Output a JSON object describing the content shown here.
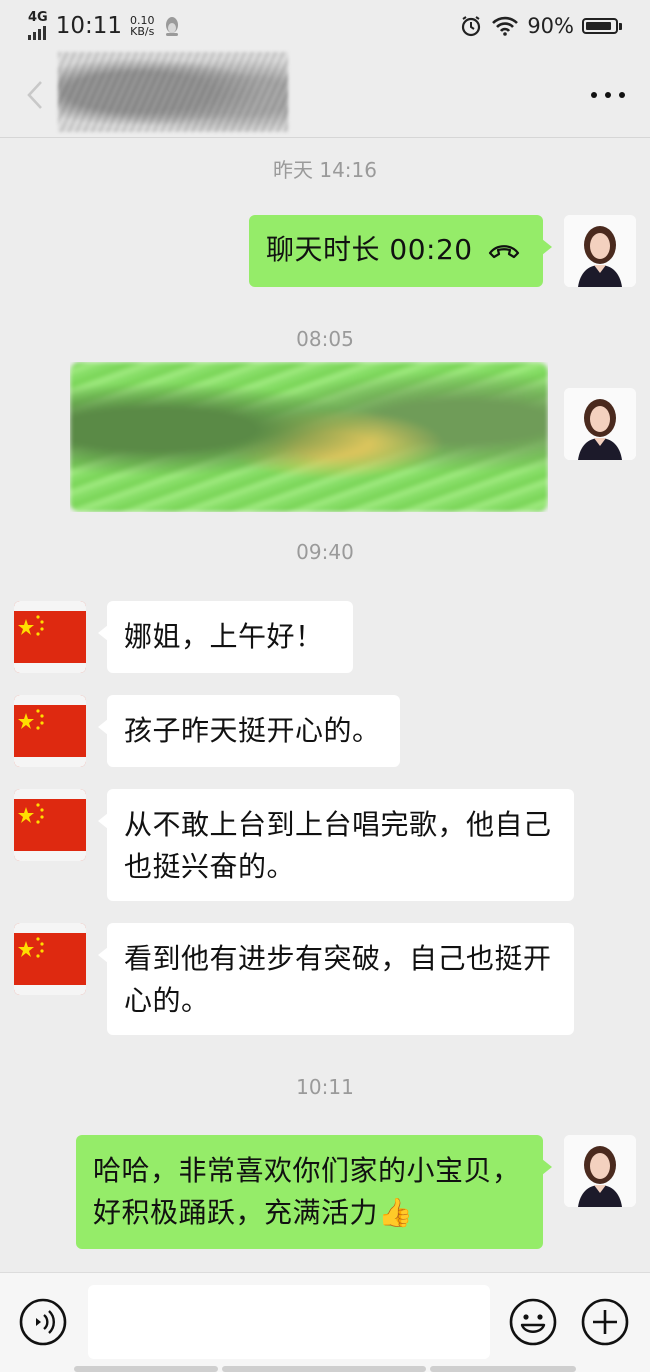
{
  "status_bar": {
    "network": "4G",
    "time": "10:11",
    "speed_value": "0.10",
    "speed_unit": "KB/s",
    "battery": "90%",
    "battery_level": 0.9
  },
  "timestamps": {
    "t1": "昨天 14:16",
    "t2": "08:05",
    "t3": "09:40",
    "t4": "10:11"
  },
  "messages": {
    "call": {
      "label": "聊天时长 00:20"
    },
    "m1": "娜姐，上午好！",
    "m2": "孩子昨天挺开心的。",
    "m3": "从不敢上台到上台唱完歌，他自己也挺兴奋的。",
    "m4": "看到他有进步有突破，自己也挺开心的。",
    "m5": "哈哈，非常喜欢你们家的小宝贝，好积极踊跃，充满活力👍"
  },
  "input": {
    "value": ""
  },
  "colors": {
    "background": "#ededed",
    "my_bubble": "#95ec69",
    "their_bubble": "#ffffff",
    "flag_red": "#de2910",
    "flag_star": "#ffde00"
  },
  "icons": {
    "back": "chevron-left-icon",
    "more": "more-dots-icon",
    "call": "phone-hangup-icon",
    "voice": "voice-icon",
    "emoji": "emoji-icon",
    "plus": "plus-icon"
  }
}
